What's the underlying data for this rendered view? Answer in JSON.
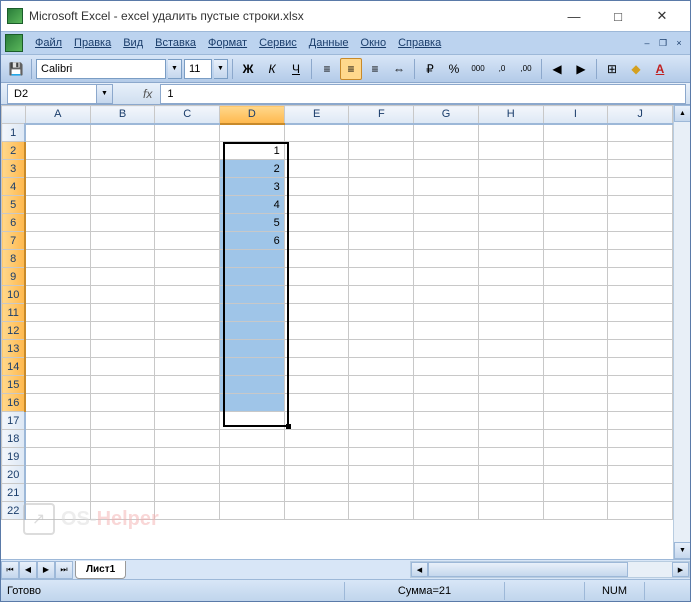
{
  "window": {
    "title": "Microsoft Excel - excel удалить пустые строки.xlsx",
    "buttons": {
      "min": "—",
      "max": "□",
      "close": "✕"
    }
  },
  "menu": {
    "items": [
      "Файл",
      "Правка",
      "Вид",
      "Вставка",
      "Формат",
      "Сервис",
      "Данные",
      "Окно",
      "Справка"
    ],
    "child_min": "–",
    "child_restore": "❐",
    "child_close": "×"
  },
  "toolbar": {
    "save_icon": "💾",
    "font_name": "Calibri",
    "font_size": "11",
    "bold": "Ж",
    "italic": "К",
    "underline": "Ч",
    "align_left": "≡",
    "align_center": "≡",
    "align_right": "≡",
    "merge": "⇔",
    "currency": "₽",
    "percent": "%",
    "comma": "000",
    "dec_inc": ",0",
    "dec_dec": ",00",
    "indent_dec": "◀",
    "indent_inc": "▶",
    "borders": "⊞",
    "fill": "◆",
    "font_color": "A"
  },
  "namebox": {
    "ref": "D2",
    "fx": "fx",
    "formula": "1"
  },
  "columns": [
    "A",
    "B",
    "C",
    "D",
    "E",
    "F",
    "G",
    "H",
    "I",
    "J"
  ],
  "rows": [
    1,
    2,
    3,
    4,
    5,
    6,
    7,
    8,
    9,
    10,
    11,
    12,
    13,
    14,
    15,
    16,
    17,
    18,
    19,
    20,
    21,
    22
  ],
  "active_cell": "D2",
  "selection": {
    "col": "D",
    "row_start": 2,
    "row_end": 16
  },
  "cells": {
    "D2": "1",
    "D3": "2",
    "D4": "3",
    "D5": "4",
    "D6": "5",
    "D7": "6"
  },
  "sheet_tabs": {
    "active": "Лист1"
  },
  "statusbar": {
    "ready": "Готово",
    "sum": "Сумма=21",
    "num": "NUM"
  },
  "watermark": {
    "text1": "OS-",
    "text2": "Helper"
  },
  "chart_data": {
    "type": "table",
    "columns": [
      "D"
    ],
    "rows": [
      {
        "row": 2,
        "D": 1
      },
      {
        "row": 3,
        "D": 2
      },
      {
        "row": 4,
        "D": 3
      },
      {
        "row": 5,
        "D": 4
      },
      {
        "row": 6,
        "D": 5
      },
      {
        "row": 7,
        "D": 6
      }
    ],
    "selection_range": "D2:D16",
    "sum": 21
  }
}
